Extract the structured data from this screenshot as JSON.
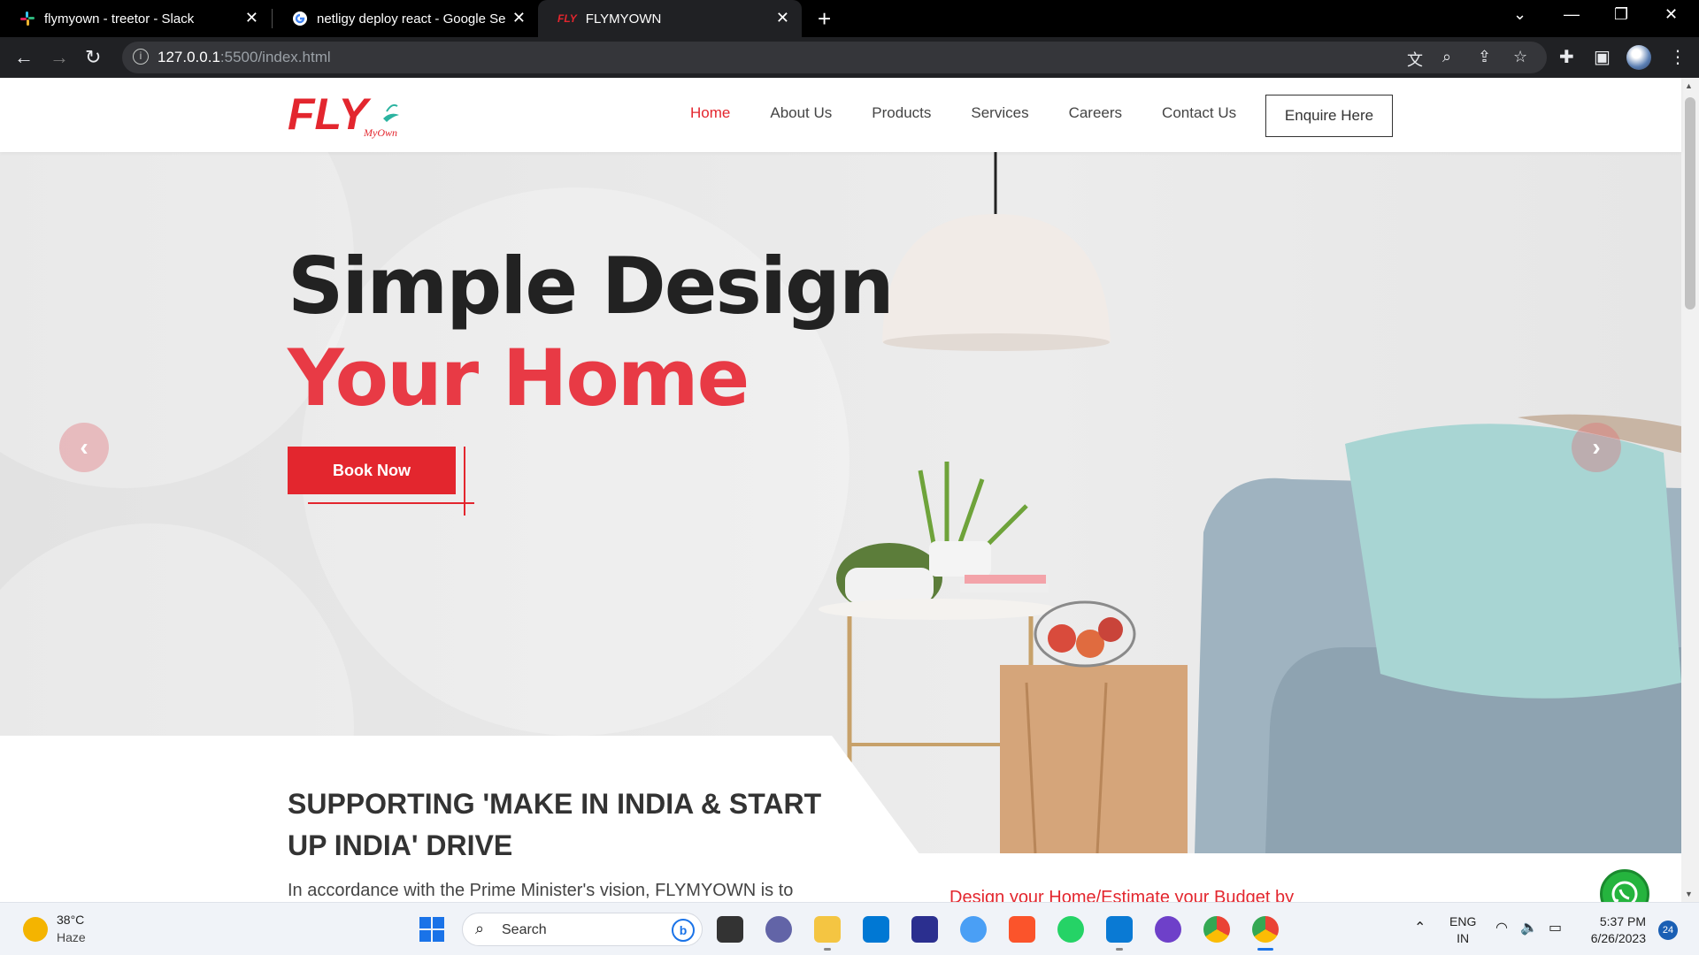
{
  "browser": {
    "tabs": [
      {
        "title": "flymyown - treetor - Slack",
        "icon": "slack-icon"
      },
      {
        "title": "netligy deploy react - Google Se",
        "icon": "google-icon"
      },
      {
        "title": "FLYMYOWN",
        "icon": "fly-favicon"
      }
    ],
    "url_host": "127.0.0.1",
    "url_path": ":5500/index.html"
  },
  "site": {
    "logo_text": "FLY",
    "logo_sub": "MyOwn",
    "nav": [
      "Home",
      "About Us",
      "Products",
      "Services",
      "Careers",
      "Contact Us"
    ],
    "enquire_label": "Enquire Here",
    "hero_line1": "Simple Design",
    "hero_line2": "Your Home",
    "book_label": "Book Now",
    "support_title": "SUPPORTING 'MAKE IN INDIA & START UP INDIA' DRIVE",
    "support_text": "In accordance with the Prime Minister's vision, FLYMYOWN is to",
    "design_text": "Design your Home/Estimate your Budget by"
  },
  "taskbar": {
    "weather_temp": "38°C",
    "weather_desc": "Haze",
    "search_placeholder": "Search",
    "lang_line1": "ENG",
    "lang_line2": "IN",
    "time": "5:37 PM",
    "date": "6/26/2023",
    "notifications": "24"
  },
  "colors": {
    "accent": "#e3262e",
    "hero_red": "#e83a45",
    "whatsapp": "#25b43e"
  }
}
